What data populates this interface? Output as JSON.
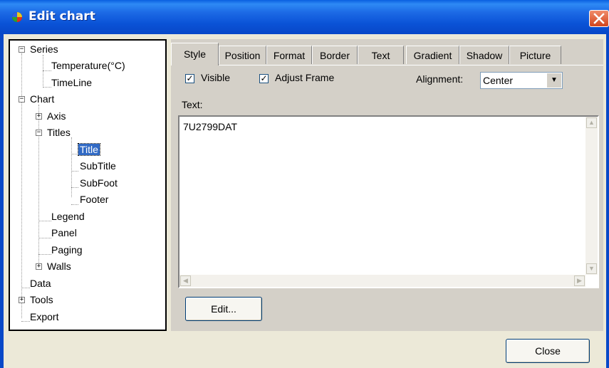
{
  "window": {
    "title": "Edit chart",
    "close_glyph": "✕"
  },
  "tree": {
    "nodes": [
      {
        "label": "Series",
        "expander": "−"
      },
      {
        "label": "Temperature(°C)"
      },
      {
        "label": "TimeLine"
      },
      {
        "label": "Chart",
        "expander": "−"
      },
      {
        "label": "Axis",
        "expander": "+"
      },
      {
        "label": "Titles",
        "expander": "−"
      },
      {
        "label": "Title",
        "selected": true
      },
      {
        "label": "SubTitle"
      },
      {
        "label": "SubFoot"
      },
      {
        "label": "Footer"
      },
      {
        "label": "Legend"
      },
      {
        "label": "Panel"
      },
      {
        "label": "Paging"
      },
      {
        "label": "Walls",
        "expander": "+"
      },
      {
        "label": "Data"
      },
      {
        "label": "Tools",
        "expander": "+"
      },
      {
        "label": "Export"
      }
    ]
  },
  "tabs": [
    {
      "label": "Style"
    },
    {
      "label": "Position"
    },
    {
      "label": "Format"
    },
    {
      "label": "Border"
    },
    {
      "label": "Text"
    },
    {
      "label": "Gradient"
    },
    {
      "label": "Shadow"
    },
    {
      "label": "Picture"
    }
  ],
  "style_tab": {
    "visible_label": "Visible",
    "visible_checked": true,
    "adjust_frame_label": "Adjust Frame",
    "adjust_frame_checked": true,
    "alignment_label": "Alignment:",
    "alignment_value": "Center",
    "text_label": "Text:",
    "text_value": "7U2799DAT",
    "edit_button": "Edit..."
  },
  "footer": {
    "close_button": "Close"
  },
  "glyphs": {
    "check": "✓",
    "combo_arrow": "▼",
    "scroll_up": "▲",
    "scroll_down": "▼",
    "scroll_left": "◀",
    "scroll_right": "▶"
  },
  "colors": {
    "titlebar": "#0A52D6",
    "selection": "#316AC5",
    "dialog_bg": "#ECE9D8",
    "close_x": "#D2451E"
  }
}
